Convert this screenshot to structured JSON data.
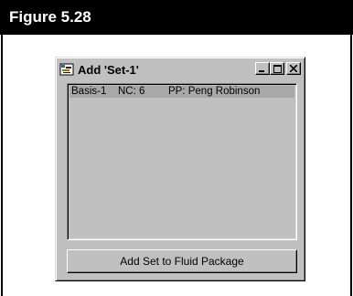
{
  "figure": {
    "label": "Figure 5.28"
  },
  "window": {
    "title": "Add 'Set-1'",
    "icon": "app-icon",
    "controls": [
      "minimize-icon",
      "maximize-icon",
      "close-icon"
    ]
  },
  "list": {
    "rows": [
      {
        "basis": "Basis-1",
        "nc": "NC: 6",
        "pp": "PP: Peng Robinson"
      }
    ]
  },
  "actions": {
    "add_set_label": "Add Set to Fluid Package"
  },
  "colors": {
    "header_bg": "#000000",
    "window_face": "#c0c0c0",
    "row_highlight": "#a8a8a8"
  }
}
